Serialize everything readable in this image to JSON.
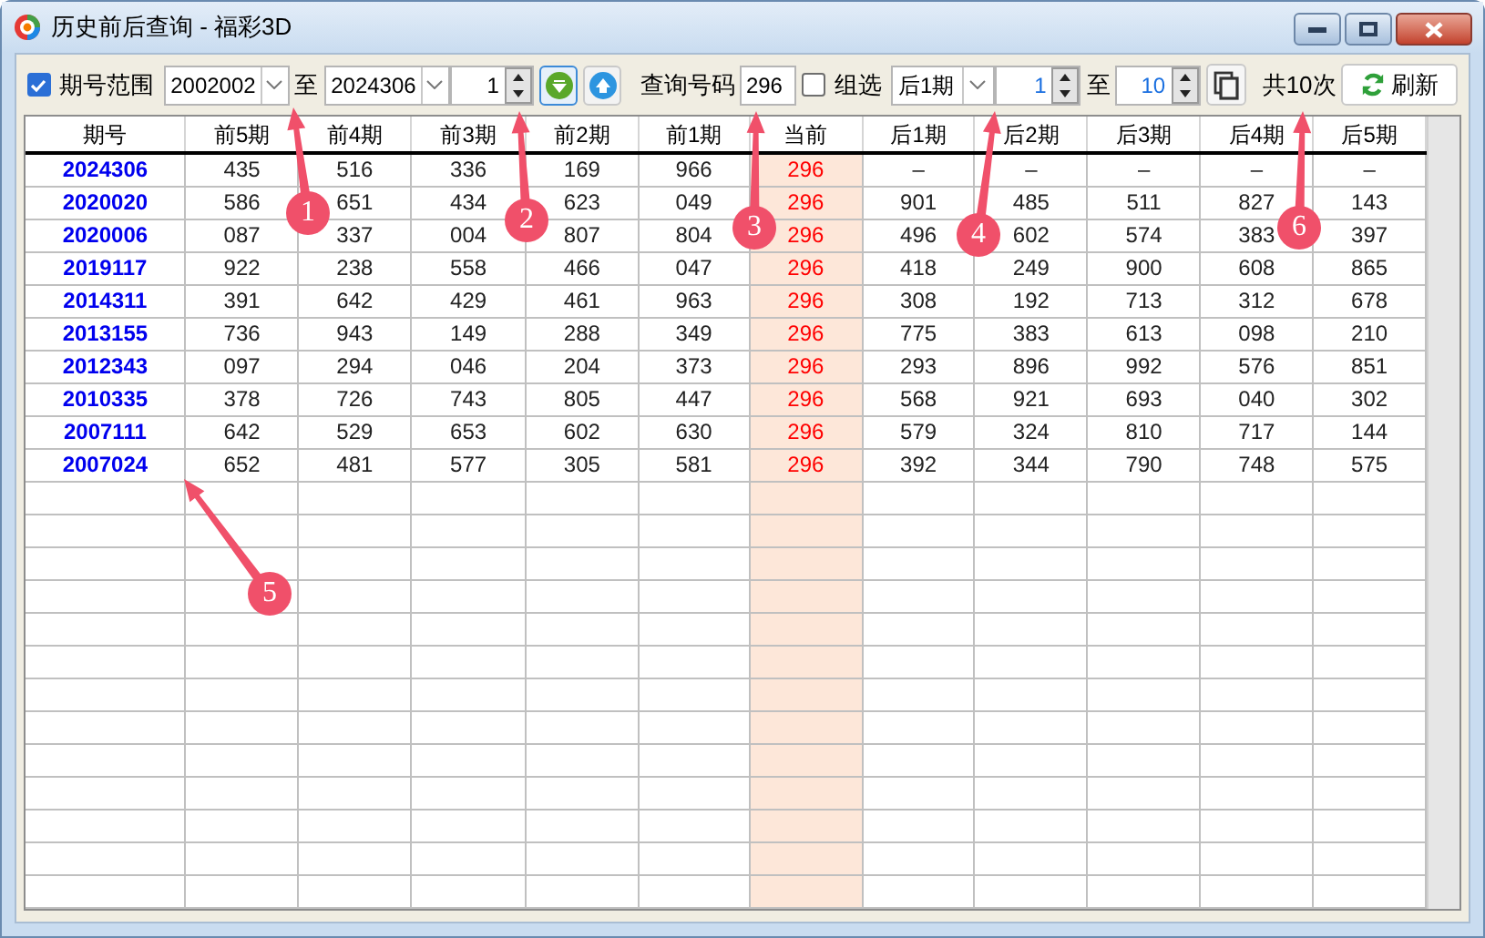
{
  "window": {
    "title": "历史前后查询 - 福彩3D"
  },
  "toolbar": {
    "range_checkbox": {
      "label": "期号范围",
      "checked": true
    },
    "from_combo": {
      "value": "2002002"
    },
    "range_to_label": "至",
    "to_combo": {
      "value": "2024306"
    },
    "step_spin": {
      "value": "1"
    },
    "query_label": "查询号码",
    "query_input": {
      "value": "296"
    },
    "group_checkbox": {
      "label": "组选",
      "checked": false
    },
    "offset_combo": {
      "value": "后1期"
    },
    "start_spin": {
      "value": "1"
    },
    "offset_to_label": "至",
    "end_spin": {
      "value": "10"
    },
    "total": "共10次",
    "refresh_button": {
      "label": "刷新"
    }
  },
  "table": {
    "columns": [
      {
        "label": "期号",
        "highlighted": false
      },
      {
        "label": "前5期",
        "highlighted": false
      },
      {
        "label": "前4期",
        "highlighted": false
      },
      {
        "label": "前3期",
        "highlighted": false
      },
      {
        "label": "前2期",
        "highlighted": false
      },
      {
        "label": "前1期",
        "highlighted": false
      },
      {
        "label": "当前",
        "highlighted": true
      },
      {
        "label": "后1期",
        "highlighted": false
      },
      {
        "label": "后2期",
        "highlighted": false
      },
      {
        "label": "后3期",
        "highlighted": false
      },
      {
        "label": "后4期",
        "highlighted": false
      },
      {
        "label": "后5期",
        "highlighted": false
      }
    ],
    "rows": [
      {
        "cells": [
          "2024306",
          "435",
          "516",
          "336",
          "169",
          "966",
          "296",
          "–",
          "–",
          "–",
          "–",
          "–"
        ]
      },
      {
        "cells": [
          "2020020",
          "586",
          "651",
          "434",
          "623",
          "049",
          "296",
          "901",
          "485",
          "511",
          "827",
          "143"
        ]
      },
      {
        "cells": [
          "2020006",
          "087",
          "337",
          "004",
          "807",
          "804",
          "296",
          "496",
          "602",
          "574",
          "383",
          "397"
        ]
      },
      {
        "cells": [
          "2019117",
          "922",
          "238",
          "558",
          "466",
          "047",
          "296",
          "418",
          "249",
          "900",
          "608",
          "865"
        ]
      },
      {
        "cells": [
          "2014311",
          "391",
          "642",
          "429",
          "461",
          "963",
          "296",
          "308",
          "192",
          "713",
          "312",
          "678"
        ]
      },
      {
        "cells": [
          "2013155",
          "736",
          "943",
          "149",
          "288",
          "349",
          "296",
          "775",
          "383",
          "613",
          "098",
          "210"
        ]
      },
      {
        "cells": [
          "2012343",
          "097",
          "294",
          "046",
          "204",
          "373",
          "296",
          "293",
          "896",
          "992",
          "576",
          "851"
        ]
      },
      {
        "cells": [
          "2010335",
          "378",
          "726",
          "743",
          "805",
          "447",
          "296",
          "568",
          "921",
          "693",
          "040",
          "302"
        ]
      },
      {
        "cells": [
          "2007111",
          "642",
          "529",
          "653",
          "602",
          "630",
          "296",
          "579",
          "324",
          "810",
          "717",
          "144"
        ]
      },
      {
        "cells": [
          "2007024",
          "652",
          "481",
          "577",
          "305",
          "581",
          "296",
          "392",
          "344",
          "790",
          "748",
          "575"
        ]
      }
    ]
  },
  "annotations": [
    {
      "label": "1"
    },
    {
      "label": "2"
    },
    {
      "label": "3"
    },
    {
      "label": "4"
    },
    {
      "label": "5"
    },
    {
      "label": "6"
    }
  ]
}
